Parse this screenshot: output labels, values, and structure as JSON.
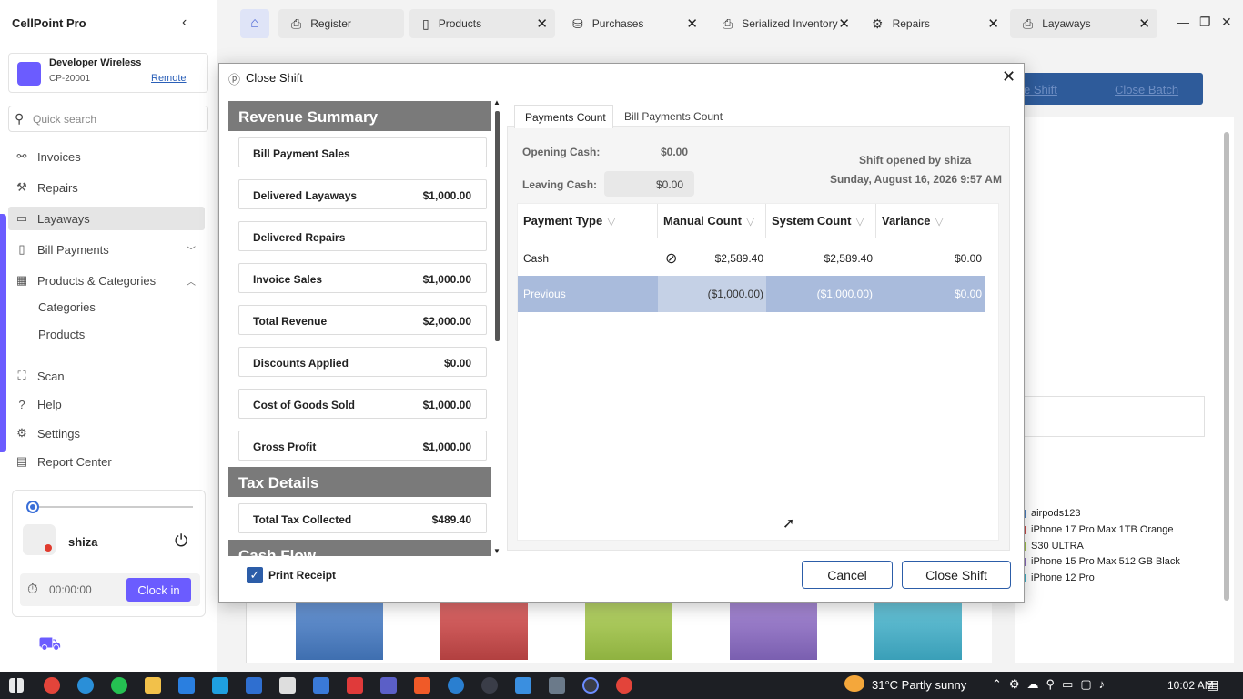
{
  "app": {
    "title": "CellPoint Pro"
  },
  "account": {
    "name": "Developer Wireless",
    "id": "CP-20001",
    "mode": "Remote"
  },
  "search": {
    "placeholder": "Quick search"
  },
  "nav": {
    "invoices": "Invoices",
    "repairs": "Repairs",
    "layaways": "Layaways",
    "bill_payments": "Bill Payments",
    "products_categories": "Products & Categories",
    "categories": "Categories",
    "products": "Products",
    "scan": "Scan",
    "help": "Help",
    "settings": "Settings",
    "report_center": "Report Center"
  },
  "user": {
    "name": "shiza",
    "timer": "00:00:00",
    "clock_in": "Clock in"
  },
  "tabs": [
    "Register",
    "Products",
    "Purchases",
    "Serialized Inventory",
    "Repairs",
    "Layaways"
  ],
  "background": {
    "link1": "e Shift",
    "link2": "Close Batch",
    "legend": [
      "airpods123",
      "iPhone 17 Pro Max 1TB Orange",
      "S30 ULTRA",
      "iPhone 15 Pro Max 512 GB Black",
      "iPhone 12 Pro"
    ],
    "legend_colors": [
      "#4a7fc1",
      "#c84a4a",
      "#9fc24a",
      "#8a6bbd",
      "#3fb1c8"
    ]
  },
  "dialog": {
    "title": "Close Shift",
    "revenue_header": "Revenue Summary",
    "revenue": [
      {
        "label": "Bill Payment Sales",
        "value": ""
      },
      {
        "label": "Delivered Layaways",
        "value": "$1,000.00"
      },
      {
        "label": "Delivered Repairs",
        "value": ""
      },
      {
        "label": "Invoice Sales",
        "value": "$1,000.00"
      },
      {
        "label": "Total Revenue",
        "value": "$2,000.00"
      },
      {
        "label": "Discounts Applied",
        "value": "$0.00"
      },
      {
        "label": "Cost of Goods Sold",
        "value": "$1,000.00"
      },
      {
        "label": "Gross Profit",
        "value": "$1,000.00"
      }
    ],
    "tax_header": "Tax Details",
    "tax": [
      {
        "label": "Total Tax Collected",
        "value": "$489.40"
      }
    ],
    "cash_header": "Cash Flow",
    "print_receipt": "Print Receipt",
    "tab_payments": "Payments Count",
    "tab_bill": "Bill Payments Count",
    "opening_label": "Opening Cash:",
    "opening_value": "$0.00",
    "leaving_label": "Leaving Cash:",
    "leaving_value": "$0.00",
    "shift_by": "Shift opened by shiza",
    "shift_date": "Sunday, August 16, 2026 9:57 AM",
    "columns": [
      "Payment Type",
      "Manual Count",
      "System Count",
      "Variance"
    ],
    "rows": [
      {
        "type": "Cash",
        "manual": "$2,589.40",
        "system": "$2,589.40",
        "variance": "$0.00"
      },
      {
        "type": "Previous",
        "manual": "($1,000.00)",
        "system": "($1,000.00)",
        "variance": "$0.00"
      }
    ],
    "cancel": "Cancel",
    "close_shift": "Close Shift"
  },
  "taskbar": {
    "weather": "31°C  Partly sunny",
    "time": "10:02 AM"
  }
}
